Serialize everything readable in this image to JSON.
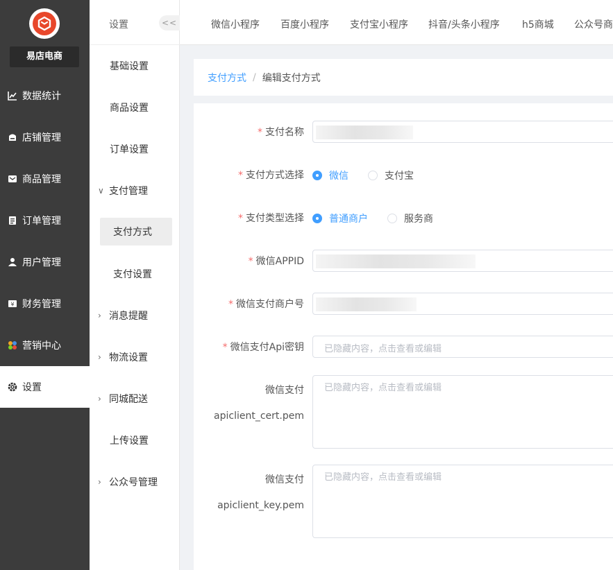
{
  "brand": {
    "name": "易店电商",
    "color": "#e8472b"
  },
  "nav": [
    {
      "label": "数据统计",
      "icon": "chart-line-icon"
    },
    {
      "label": "店铺管理",
      "icon": "store-icon"
    },
    {
      "label": "商品管理",
      "icon": "mail-box-icon"
    },
    {
      "label": "订单管理",
      "icon": "order-list-icon"
    },
    {
      "label": "用户管理",
      "icon": "user-icon"
    },
    {
      "label": "财务管理",
      "icon": "yen-finance-icon"
    },
    {
      "label": "营销中心",
      "icon": "marketing-icon"
    },
    {
      "label": "设置",
      "icon": "gear-icon",
      "active": true
    }
  ],
  "submenu": {
    "title": "设置",
    "collapse_label": "<<",
    "items": [
      {
        "label": "基础设置"
      },
      {
        "label": "商品设置"
      },
      {
        "label": "订单设置"
      },
      {
        "label": "支付管理",
        "expanded": true
      },
      {
        "label": "支付方式",
        "selected": true
      },
      {
        "label": "支付设置"
      },
      {
        "label": "消息提醒"
      },
      {
        "label": "物流设置"
      },
      {
        "label": "同城配送"
      },
      {
        "label": "上传设置"
      },
      {
        "label": "公众号管理"
      }
    ]
  },
  "tabs": [
    "微信小程序",
    "百度小程序",
    "支付宝小程序",
    "抖音/头条小程序",
    "h5商城",
    "公众号商"
  ],
  "breadcrumb": {
    "parent": "支付方式",
    "separator": "/",
    "current": "编辑支付方式"
  },
  "form": {
    "pay_name_label": "支付名称",
    "pay_method_label": "支付方式选择",
    "pay_method_options": [
      "微信",
      "支付宝"
    ],
    "pay_type_label": "支付类型选择",
    "pay_type_options": [
      "普通商户",
      "服务商"
    ],
    "appid_label": "微信APPID",
    "merchant_label": "微信支付商户号",
    "apikey_label": "微信支付Api密钥",
    "apikey_placeholder": "已隐藏内容，点击查看或编辑",
    "cert_label_1": "微信支付",
    "cert_label_2": "apiclient_cert.pem",
    "cert_placeholder": "已隐藏内容，点击查看或编辑",
    "key_label_1": "微信支付",
    "key_label_2": "apiclient_key.pem",
    "key_placeholder": "已隐藏内容，点击查看或编辑"
  },
  "colors": {
    "accent": "#409eff",
    "required": "#f56c6c",
    "sidebar": "#3c3c3c"
  }
}
